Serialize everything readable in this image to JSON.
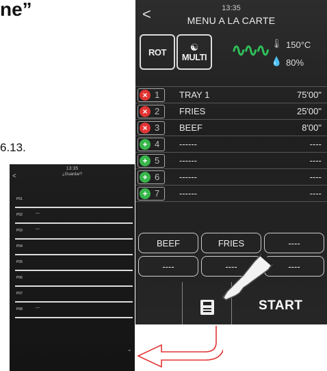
{
  "document": {
    "heading_fragment": "ne”",
    "ref_fragment": "6.13."
  },
  "main_screen": {
    "time": "13:35",
    "title": "MENU A LA CARTE",
    "back_glyph": "<",
    "modes": [
      {
        "label": "ROT",
        "icon": "rotation-icon"
      },
      {
        "label": "MULTI",
        "icon": "chef-hat-icon"
      }
    ],
    "steam_icon": "steam-icon",
    "temperature": "150°C",
    "humidity": "80%",
    "trays": [
      {
        "num": "1",
        "name": "TRAY 1",
        "time": "75'00\"",
        "status": "remove"
      },
      {
        "num": "2",
        "name": "FRIES",
        "time": "25'00\"",
        "status": "remove"
      },
      {
        "num": "3",
        "name": "BEEF",
        "time": "8'00\"",
        "status": "remove"
      },
      {
        "num": "4",
        "name": "------",
        "time": "----",
        "status": "add"
      },
      {
        "num": "5",
        "name": "------",
        "time": "----",
        "status": "add"
      },
      {
        "num": "6",
        "name": "------",
        "time": "----",
        "status": "add"
      },
      {
        "num": "7",
        "name": "------",
        "time": "----",
        "status": "add"
      }
    ],
    "recipe_buttons": [
      "BEEF",
      "FRIES",
      "----",
      "----",
      "----",
      "----"
    ],
    "start_label": "START",
    "colors": {
      "remove": "#e23434",
      "add": "#37b64b",
      "steam": "#2fc05a"
    }
  },
  "save_screen": {
    "time": "13:35",
    "title": "¿Guardar?",
    "back_glyph": "<",
    "programs": [
      {
        "name": "P01",
        "value": ""
      },
      {
        "name": "P02",
        "value": "—"
      },
      {
        "name": "P03",
        "value": "—"
      },
      {
        "name": "P04",
        "value": ""
      },
      {
        "name": "P05",
        "value": ""
      },
      {
        "name": "P06",
        "value": ""
      },
      {
        "name": "P07",
        "value": ""
      },
      {
        "name": "P08",
        "value": "—"
      }
    ],
    "chevron_glyph": "⌄"
  },
  "arrow_color": "#e23434"
}
